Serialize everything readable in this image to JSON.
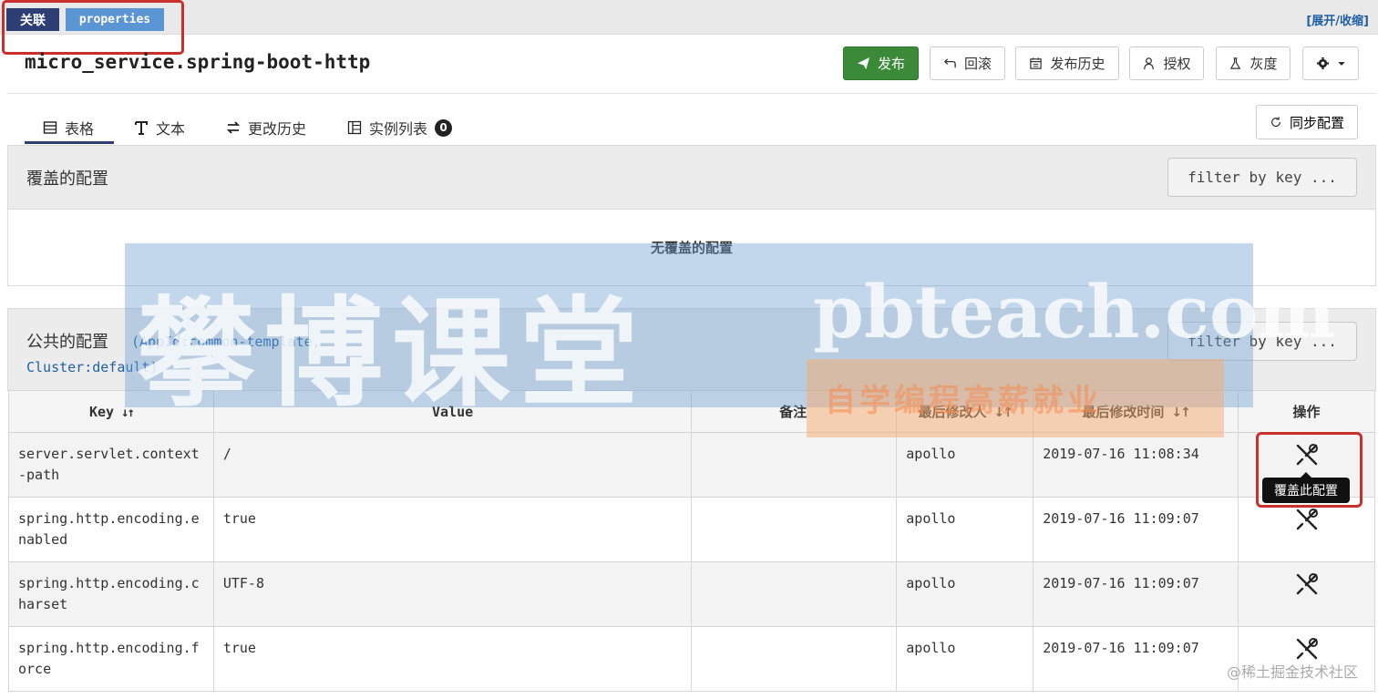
{
  "header": {
    "relation_label": "关联",
    "format_label": "properties",
    "expand_collapse": "[展开/收缩]",
    "namespace_title": "micro_service.spring-boot-http"
  },
  "toolbar": {
    "publish": "发布",
    "rollback": "回滚",
    "publish_history": "发布历史",
    "authorize": "授权",
    "gray": "灰度",
    "sync_config": "同步配置"
  },
  "tabs": [
    {
      "label": "表格",
      "icon": "table-icon"
    },
    {
      "label": "文本",
      "icon": "text-icon"
    },
    {
      "label": "更改历史",
      "icon": "exchange-icon"
    },
    {
      "label": "实例列表",
      "icon": "instance-list-icon",
      "badge": "0"
    }
  ],
  "override_panel": {
    "title": "覆盖的配置",
    "filter_placeholder": "filter by key ...",
    "empty_text": "无覆盖的配置"
  },
  "public_panel": {
    "title": "公共的配置",
    "sub1": "(AppId:common-template,",
    "sub2": "Cluster:default)",
    "filter_placeholder": "filter by key ..."
  },
  "table": {
    "headers": [
      "Key",
      "Value",
      "备注",
      "最后修改人",
      "最后修改时间",
      "操作"
    ],
    "rows": [
      {
        "key": "server.servlet.context-path",
        "value": "/",
        "comment": "",
        "modifier": "apollo",
        "time": "2019-07-16 11:08:34"
      },
      {
        "key": "spring.http.encoding.enabled",
        "value": "true",
        "comment": "",
        "modifier": "apollo",
        "time": "2019-07-16 11:09:07"
      },
      {
        "key": "spring.http.encoding.charset",
        "value": "UTF-8",
        "comment": "",
        "modifier": "apollo",
        "time": "2019-07-16 11:09:07"
      },
      {
        "key": "spring.http.encoding.force",
        "value": "true",
        "comment": "",
        "modifier": "apollo",
        "time": "2019-07-16 11:09:07"
      }
    ]
  },
  "tooltip": "覆盖此配置",
  "watermark": {
    "big": "攀博课堂",
    "domain": "pbteach.com",
    "sub": "自学编程高薪就业"
  },
  "credit": "@稀土掘金技术社区",
  "colors": {
    "publish_green": "#3a8a3a",
    "label_dark": "#2c3e73",
    "label_blue": "#5b95d3",
    "highlight_red": "#c9302c"
  }
}
